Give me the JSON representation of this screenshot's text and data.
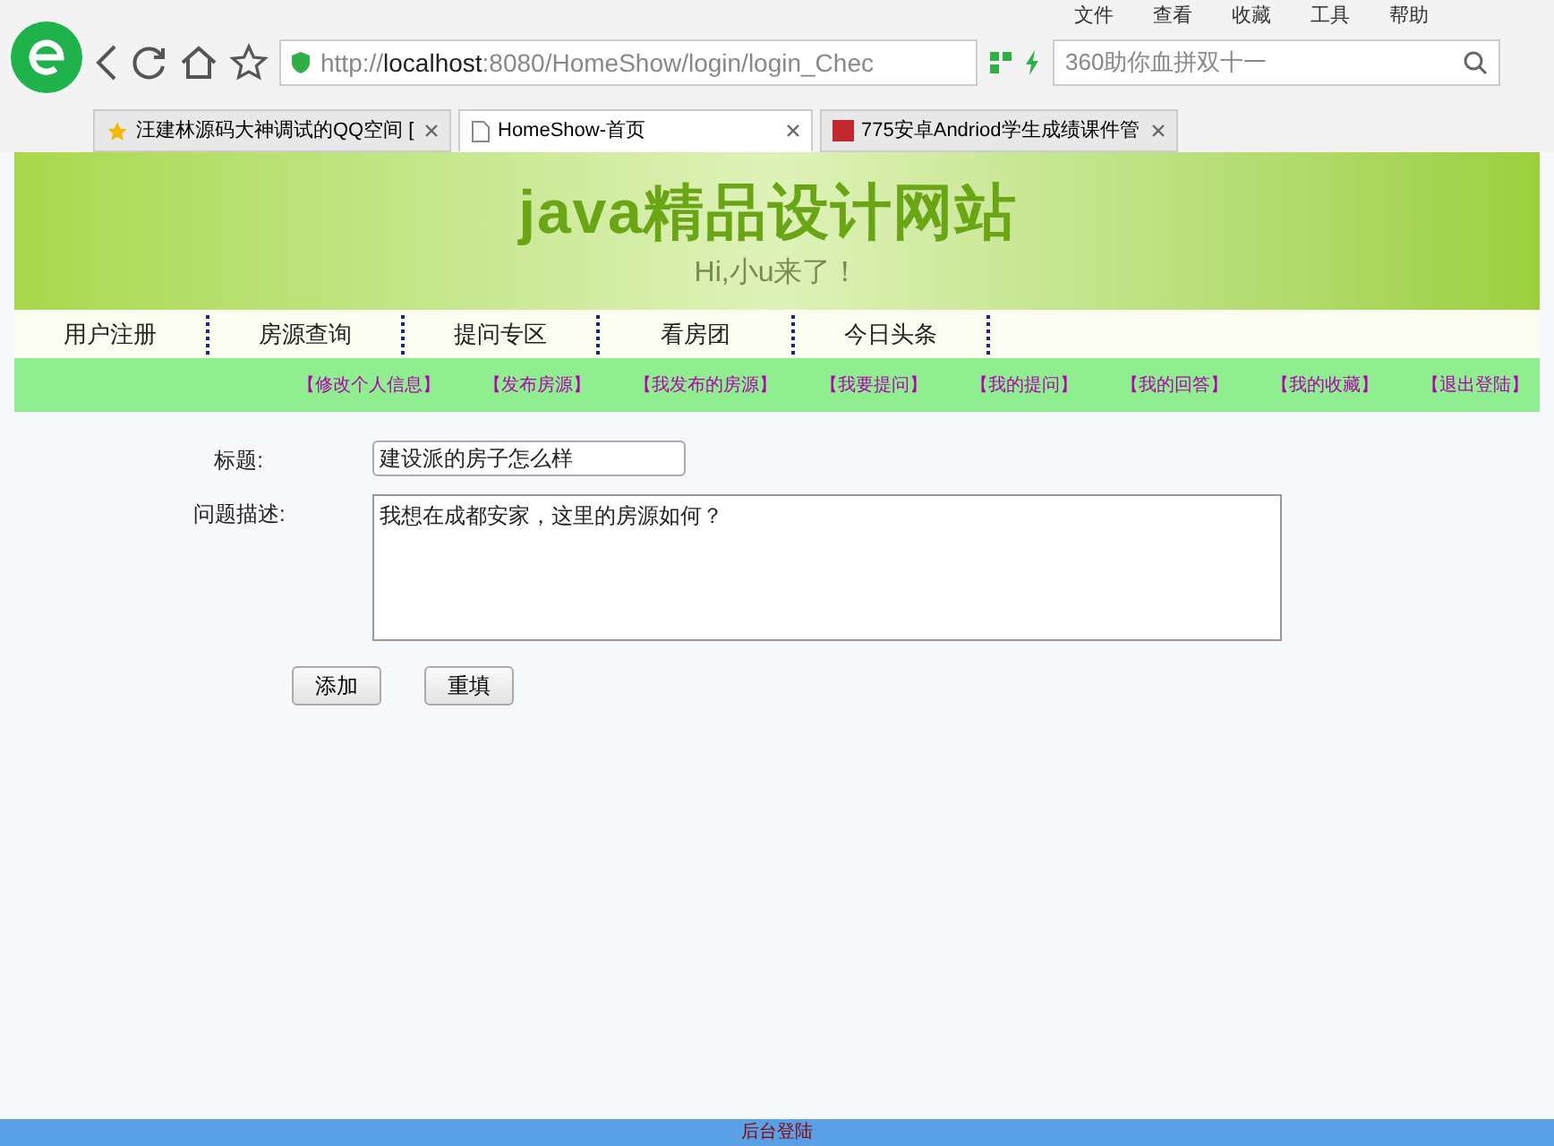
{
  "browser": {
    "menu": [
      "文件",
      "查看",
      "收藏",
      "工具",
      "帮助"
    ],
    "address": {
      "prefix": "http://",
      "host": "localhost",
      "rest": ":8080/HomeShow/login/login_Chec"
    },
    "search": {
      "placeholder": "360助你血拼双十一"
    },
    "tabs": [
      {
        "label": "汪建林源码大神调试的QQ空间 [",
        "selected": false
      },
      {
        "label": "HomeShow-首页",
        "selected": true
      },
      {
        "label": "775安卓Andriod学生成绩课件管",
        "selected": false
      }
    ]
  },
  "banner": {
    "title": "java精品设计网站",
    "subtitle": "Hi,小u来了！"
  },
  "nav": [
    "用户注册",
    "房源查询",
    "提问专区",
    "看房团",
    "今日头条"
  ],
  "links": [
    "【修改个人信息】",
    "【发布房源】",
    "【我发布的房源】",
    "【我要提问】",
    "【我的提问】",
    "【我的回答】",
    "【我的收藏】",
    "【退出登陆】"
  ],
  "form": {
    "title_label": "标题:",
    "title_value": "建设派的房子怎么样",
    "desc_label": "问题描述:",
    "desc_value": "我想在成都安家，这里的房源如何？",
    "buttons": [
      "添加",
      "重填"
    ]
  },
  "footer": "后台登陆"
}
